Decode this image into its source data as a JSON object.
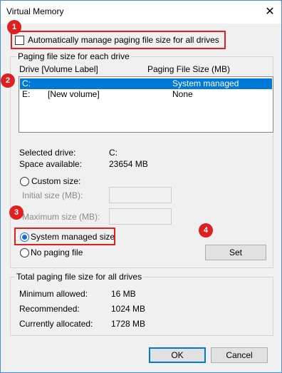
{
  "window": {
    "title": "Virtual Memory",
    "close_glyph": "✕"
  },
  "auto_manage": {
    "label": "Automatically manage paging file size for all drives",
    "checked": false
  },
  "paging_group": {
    "legend": "Paging file size for each drive",
    "col_drive": "Drive  [Volume Label]",
    "col_size": "Paging File Size (MB)",
    "drives": [
      {
        "drive": "C:",
        "label": "",
        "size": "System managed",
        "selected": true
      },
      {
        "drive": "E:",
        "label": "[New volume]",
        "size": "None",
        "selected": false
      }
    ]
  },
  "selected_drive": {
    "label": "Selected drive:",
    "value": "C:"
  },
  "space_available": {
    "label": "Space available:",
    "value": "23654 MB"
  },
  "options": {
    "custom_size": "Custom size:",
    "initial_size": "Initial size (MB):",
    "maximum_size": "Maximum size (MB):",
    "system_managed": "System managed size",
    "no_paging": "No paging file",
    "selected_option": "system_managed"
  },
  "set_button": "Set",
  "totals_group": {
    "legend": "Total paging file size for all drives",
    "minimum_label": "Minimum allowed:",
    "minimum_value": "16 MB",
    "recommended_label": "Recommended:",
    "recommended_value": "1024 MB",
    "allocated_label": "Currently allocated:",
    "allocated_value": "1728 MB"
  },
  "ok_button": "OK",
  "cancel_button": "Cancel",
  "annotations": {
    "m1": "1",
    "m2": "2",
    "m3": "3",
    "m4": "4"
  },
  "colors": {
    "annotation": "#e02020",
    "selection": "#0078d7"
  }
}
